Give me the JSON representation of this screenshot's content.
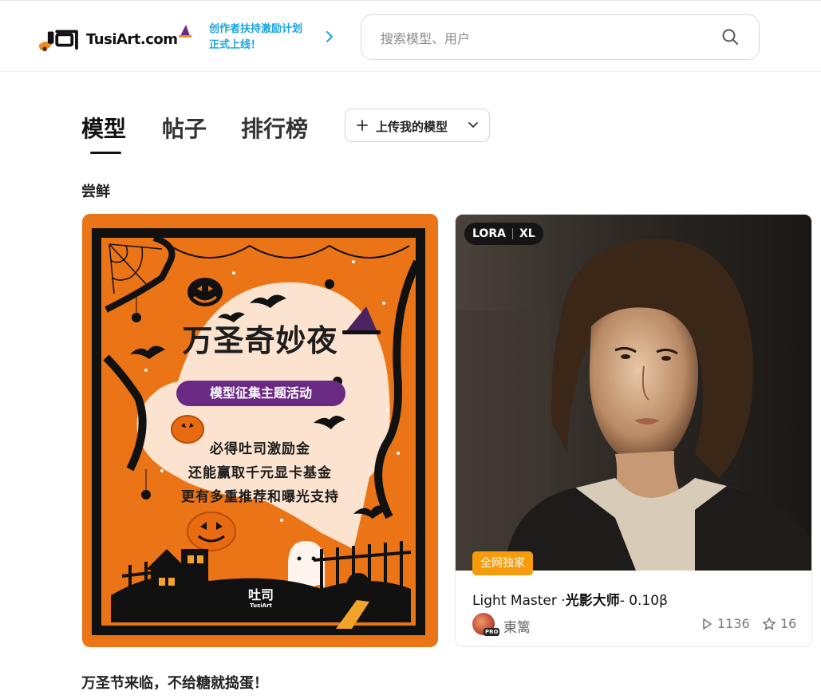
{
  "header": {
    "logo_text": "TusiArt.com",
    "promo_line1": "创作者扶持激励计划",
    "promo_line2": "正式上线！",
    "search_placeholder": "搜索模型、用户"
  },
  "tabs": [
    {
      "label": "模型",
      "active": true
    },
    {
      "label": "帖子",
      "active": false
    },
    {
      "label": "排行榜",
      "active": false
    }
  ],
  "upload_button": {
    "label": "上传我的模型"
  },
  "section_title": "尝鲜",
  "event_card": {
    "poster_title": "万圣奇妙夜",
    "poster_badge": "模型征集主题活动",
    "poster_lines": [
      "必得吐司激励金",
      "还能赢取千元显卡基金",
      "更有多重推荐和曝光支持"
    ],
    "poster_logo": "吐司",
    "poster_logo_small": "TusiArt",
    "caption": "万圣节来临，不给糖就捣蛋！"
  },
  "model_card": {
    "tag_type": "LORA",
    "tag_base": "XL",
    "badge": "全网独家",
    "name_prefix": "Light Master ·",
    "name_bold": "光影大师",
    "name_suffix": "- 0.10β",
    "author": "東篱",
    "author_badge": "PRO",
    "runs": "1136",
    "stars": "16"
  },
  "colors": {
    "accent_blue": "#1aa3e0",
    "poster_orange": "#ea7416",
    "badge_orange": "#f59b0c",
    "badge_purple": "#6a2a83"
  },
  "icons": [
    "search-icon",
    "chevron-right-icon",
    "plus-icon",
    "chevron-down-icon",
    "play-icon",
    "star-icon"
  ]
}
